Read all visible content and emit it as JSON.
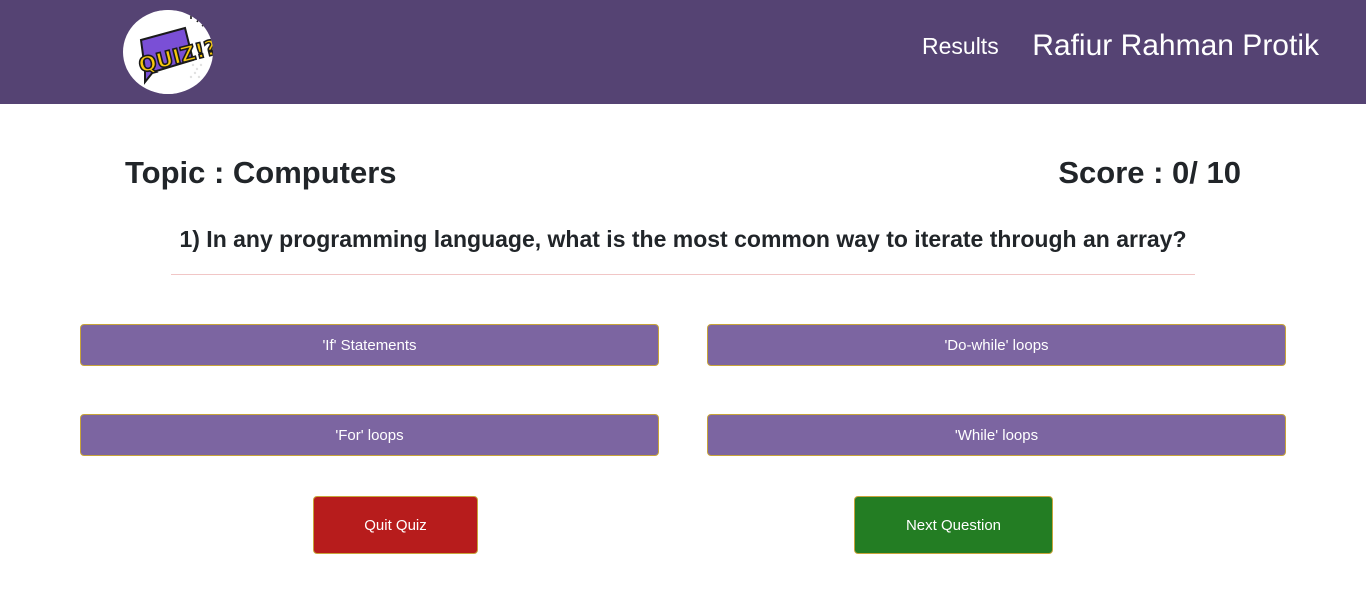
{
  "nav": {
    "logo_text": "QUIZ!?",
    "results_label": "Results",
    "user_name": "Rafiur Rahman Protik"
  },
  "quiz": {
    "topic": "Topic : Computers",
    "score": "Score : 0/ 10",
    "question": "1) In any programming language, what is the most common way to iterate through an array?",
    "options": [
      "'If' Statements",
      "'Do-while' loops",
      "'For' loops",
      "'While' loops"
    ]
  },
  "actions": {
    "quit_label": "Quit Quiz",
    "next_label": "Next Question"
  },
  "colors": {
    "navbar": "#554373",
    "option": "#7c65a1",
    "quit": "#b71c1c",
    "next": "#237d23"
  }
}
